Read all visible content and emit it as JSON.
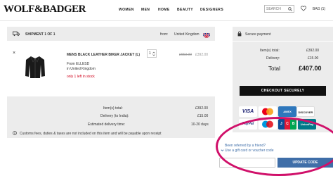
{
  "header": {
    "logo": "WOLF&BADGER",
    "nav": [
      "WOMEN",
      "MEN",
      "HOME",
      "BEAUTY",
      "DESIGNERS"
    ],
    "search_placeholder": "SEARCH",
    "bag_label": "BAG (1)"
  },
  "shipment": {
    "title": "SHIPMENT 1 OF 1",
    "from_label": "from:",
    "from_value": "United Kingdom"
  },
  "product": {
    "remove": "×",
    "name": "MENS BLACK LEATHER BIKER JACKET (L)",
    "maker": "From ELLESD",
    "origin": "in United Kingdom",
    "stock": "only 1 left in stock",
    "qty": "1",
    "old_price": "£653.00",
    "price": "£392.00"
  },
  "shipment_summary": {
    "items_label": "Item(s) total:",
    "items_value": "£392.00",
    "delivery_label": "Delivery (to India):",
    "delivery_value": "£15.00",
    "eta_label": "Estimated delivery time:",
    "eta_value": "10-20 days",
    "customs_note": "Customs fees, duties & taxes are not included on this item and will be payable upon receipt"
  },
  "secure": {
    "title": "Secure payment",
    "items_label": "Item(s) total:",
    "items_value": "£392.00",
    "delivery_label": "Delivery:",
    "delivery_value": "£15.00",
    "total_label": "Total",
    "total_value": "£407.00",
    "checkout": "CHECKOUT SECURELY"
  },
  "cards": [
    "VISA",
    "MC",
    "AMEX",
    "DISCOVER",
    "PayPal",
    "Maestro",
    "JCB",
    "UnionPay"
  ],
  "promo": {
    "referred": "Been referred by a friend?",
    "gift": "Use a gift card or voucher code",
    "update": "UPDATE CODE"
  },
  "colors": {
    "accent_blue": "#3f6ea8",
    "highlight_ring": "#d0106a",
    "stock_red": "#d0021b"
  }
}
